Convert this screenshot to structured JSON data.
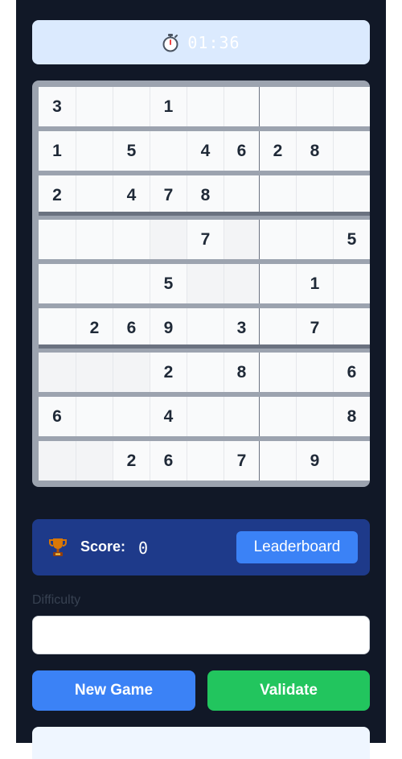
{
  "timer": {
    "icon": "stopwatch-icon",
    "time": "01:36"
  },
  "board": {
    "rows": [
      [
        "3",
        "",
        "",
        "1",
        "",
        "",
        "",
        "",
        ""
      ],
      [
        "1",
        "",
        "5",
        "",
        "4",
        "6",
        "2",
        "8",
        ""
      ],
      [
        "2",
        "",
        "4",
        "7",
        "8",
        "",
        "",
        "",
        ""
      ],
      [
        "",
        "",
        "",
        "",
        "7",
        "",
        "",
        "",
        "5"
      ],
      [
        "",
        "",
        "",
        "5",
        "",
        "",
        "",
        "1",
        ""
      ],
      [
        "",
        "2",
        "6",
        "9",
        "",
        "3",
        "",
        "7",
        ""
      ],
      [
        "",
        "",
        "",
        "2",
        "",
        "8",
        "",
        "",
        "6"
      ],
      [
        "6",
        "",
        "",
        "4",
        "",
        "",
        "",
        "",
        "8"
      ],
      [
        "",
        "",
        "2",
        "6",
        "",
        "7",
        "",
        "9",
        ""
      ]
    ]
  },
  "score": {
    "icon": "trophy-icon",
    "label": "Score:",
    "value": "0",
    "leaderboard_label": "Leaderboard"
  },
  "difficulty": {
    "label": "Difficulty",
    "value": ""
  },
  "actions": {
    "new_game_label": "New Game",
    "validate_label": "Validate"
  },
  "colors": {
    "panel": "#111827",
    "accent": "#3b82f6",
    "success": "#22c55e",
    "score_card": "#1e3a8a",
    "timer_bg": "#dbeafe"
  }
}
